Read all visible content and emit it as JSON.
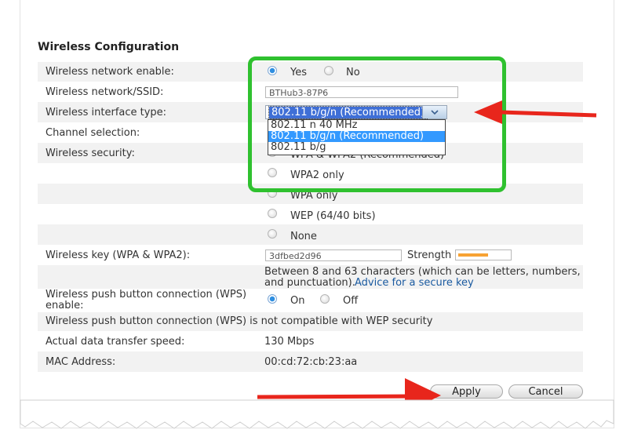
{
  "section_title": "Wireless Configuration",
  "network_enable": {
    "label": "Wireless network enable:",
    "yes": "Yes",
    "no": "No",
    "selected": "Yes"
  },
  "ssid": {
    "label": "Wireless network/SSID:",
    "value": "BTHub3-87P6"
  },
  "interface_type": {
    "label": "Wireless interface type:",
    "selected": "802.11 b/g/n (Recommended)",
    "options": [
      "802.11 n 40 MHz",
      "802.11 b/g/n (Recommended)",
      "802.11 b/g"
    ]
  },
  "channel": {
    "label": "Channel selection:"
  },
  "security": {
    "label": "Wireless security:",
    "options": [
      "WPA & WPA2 (Recommended)",
      "WPA2 only",
      "WPA only",
      "WEP (64/40 bits)",
      "None"
    ]
  },
  "key": {
    "label": "Wireless key (WPA & WPA2):",
    "value": "3dfbed2d96",
    "strength_label": "Strength",
    "strength_level": 0.6,
    "hint": "Between 8 and 63 characters (which can be letters, numbers,",
    "hint2": "and punctuation).",
    "advice_link": "Advice for a secure key"
  },
  "wps": {
    "label_line1": "Wireless push button connection (WPS)",
    "label_line2": "enable:",
    "on": "On",
    "off": "Off",
    "selected": "On",
    "note": "Wireless push button connection (WPS) is not compatible with WEP security"
  },
  "speed": {
    "label": "Actual data transfer speed:",
    "value": "130 Mbps"
  },
  "mac": {
    "label": "MAC Address:",
    "value": "00:cd:72:cb:23:aa"
  },
  "buttons": {
    "apply": "Apply",
    "cancel": "Cancel"
  },
  "colors": {
    "highlight_box": "#2fc12f",
    "arrow": "#e8261c",
    "row_shade": "#f2f2f2",
    "link": "#1a5aa0"
  }
}
